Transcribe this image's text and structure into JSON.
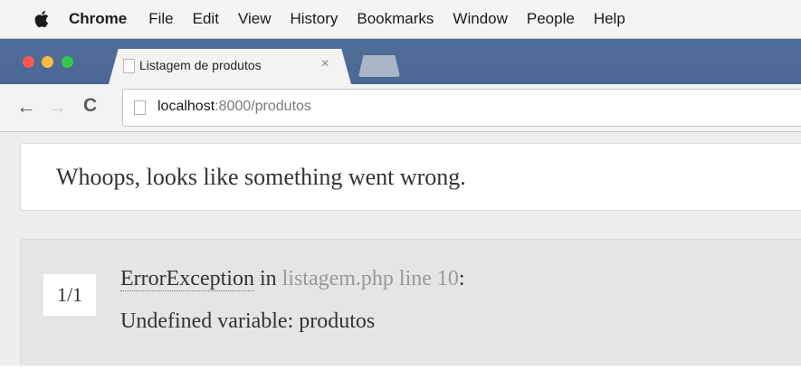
{
  "menubar": {
    "app_name": "Chrome",
    "items": [
      "File",
      "Edit",
      "View",
      "History",
      "Bookmarks",
      "Window",
      "People",
      "Help"
    ]
  },
  "tab": {
    "title": "Listagem de produtos",
    "close": "×"
  },
  "toolbar": {
    "back": "←",
    "forward": "→",
    "reload": "C",
    "url_host": "localhost",
    "url_rest": ":8000/produtos"
  },
  "error": {
    "headline": "Whoops, looks like something went wrong.",
    "counter": "1/1",
    "exception_class": "ErrorException",
    "in_word": " in ",
    "location": "listagem.php line 10",
    "colon": ":",
    "message": "Undefined variable: produtos"
  },
  "colors": {
    "tabstrip": "#4f6e98",
    "traffic_red": "#fc5753",
    "traffic_yellow": "#fdbc40",
    "traffic_green": "#34c84a"
  }
}
